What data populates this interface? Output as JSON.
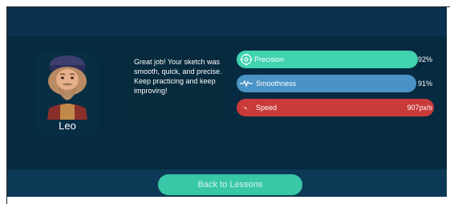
{
  "character": {
    "name": "Leo"
  },
  "feedback": {
    "message": "Great job! Your sketch was smooth, quick, and precise. Keep practicing and keep improving!"
  },
  "metrics": [
    {
      "label": "Precision",
      "value": "92%",
      "fraction": 0.92,
      "color": "#3fd3b0",
      "icon": "target-icon"
    },
    {
      "label": "Smoothness",
      "value": "91%",
      "fraction": 0.91,
      "color": "#4a93c6",
      "icon": "wave-icon"
    },
    {
      "label": "Speed",
      "value": "907px/s",
      "fraction": 1.0,
      "color": "#c93a3a",
      "icon": "lightning-icon"
    }
  ],
  "actions": {
    "back_label": "Back to Lessons"
  },
  "colors": {
    "background_top": "#0b3150",
    "background_main": "#062a3f",
    "background_bottom": "#0c3a56",
    "accent": "#38c7a7"
  }
}
